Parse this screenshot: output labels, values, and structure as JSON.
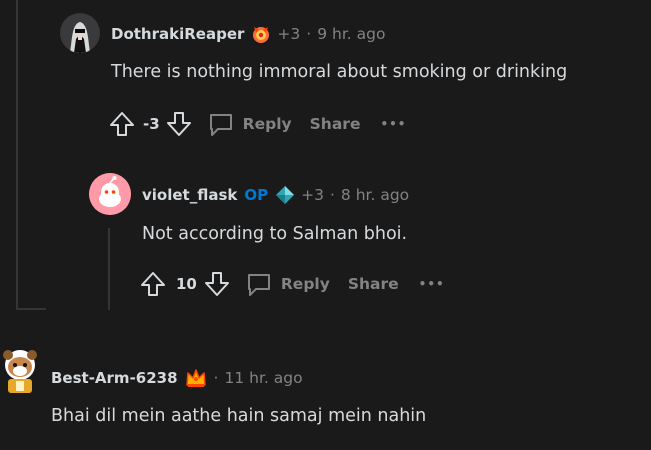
{
  "comments": [
    {
      "username": "DothrakiReaper",
      "op_badge": "",
      "karma": "+3",
      "separator": "·",
      "time": "9 hr. ago",
      "text": "There is nothing immoral about smoking or drinking",
      "votes": "-3",
      "reply_label": "Reply",
      "share_label": "Share",
      "more": "•••",
      "flair_icon": "fire-award-icon"
    },
    {
      "username": "violet_flask",
      "op_badge": "OP",
      "karma": "+3",
      "separator": "·",
      "time": "8 hr. ago",
      "text": "Not according to Salman bhoi.",
      "votes": "10",
      "reply_label": "Reply",
      "share_label": "Share",
      "more": "•••",
      "flair_icon": "diamond-icon"
    },
    {
      "username": "Best-Arm-6238",
      "karma": "",
      "separator": "·",
      "time": "11 hr. ago",
      "text": "Bhai dil mein aathe hain samaj mein nahin",
      "flair_icon": "crown-award-icon"
    }
  ],
  "colors": {
    "background": "#1a1a1b",
    "text": "#d7dadc",
    "muted": "#818384",
    "op": "#0079d3",
    "thread_line": "#343536"
  }
}
